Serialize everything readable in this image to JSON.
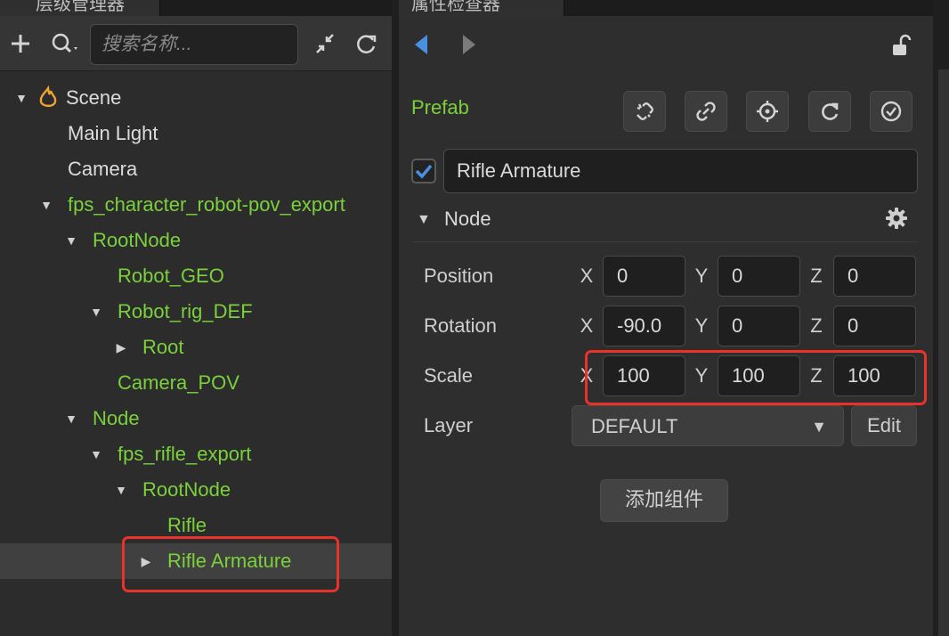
{
  "hierarchy": {
    "tab_title": "层级管理器",
    "search_placeholder": "搜索名称...",
    "tree": [
      {
        "label": "Scene",
        "color": "white",
        "expanded": true,
        "icon": "scene-flame-icon"
      },
      {
        "label": "Main Light",
        "color": "white"
      },
      {
        "label": "Camera",
        "color": "white"
      },
      {
        "label": "fps_character_robot-pov_export",
        "color": "green",
        "expanded": true
      },
      {
        "label": "RootNode",
        "color": "green",
        "expanded": true
      },
      {
        "label": "Robot_GEO",
        "color": "green"
      },
      {
        "label": "Robot_rig_DEF",
        "color": "green",
        "expanded": true
      },
      {
        "label": "Root",
        "color": "green",
        "expanded": false
      },
      {
        "label": "Camera_POV",
        "color": "green"
      },
      {
        "label": "Node",
        "color": "green",
        "expanded": true
      },
      {
        "label": "fps_rifle_export",
        "color": "green",
        "expanded": true
      },
      {
        "label": "RootNode",
        "color": "green",
        "expanded": true
      },
      {
        "label": "Rifle",
        "color": "green"
      },
      {
        "label": "Rifle Armature",
        "color": "green",
        "expanded": false,
        "selected": true
      }
    ]
  },
  "inspector": {
    "tab_title": "属性检查器",
    "prefab_label": "Prefab",
    "node_enabled": true,
    "node_name": "Rifle Armature",
    "node_section": "Node",
    "position": {
      "label": "Position",
      "x": "0",
      "y": "0",
      "z": "0"
    },
    "rotation": {
      "label": "Rotation",
      "x": "-90.0",
      "y": "0",
      "z": "0"
    },
    "scale": {
      "label": "Scale",
      "x": "100",
      "y": "100",
      "z": "100"
    },
    "axis": {
      "x": "X",
      "y": "Y",
      "z": "Z"
    },
    "layer": {
      "label": "Layer",
      "value": "DEFAULT",
      "edit": "Edit"
    },
    "add_component": "添加组件"
  },
  "colors": {
    "accent_green": "#7ad13b",
    "highlight_red": "#e8322a",
    "checkbox_blue": "#4a90e2"
  }
}
